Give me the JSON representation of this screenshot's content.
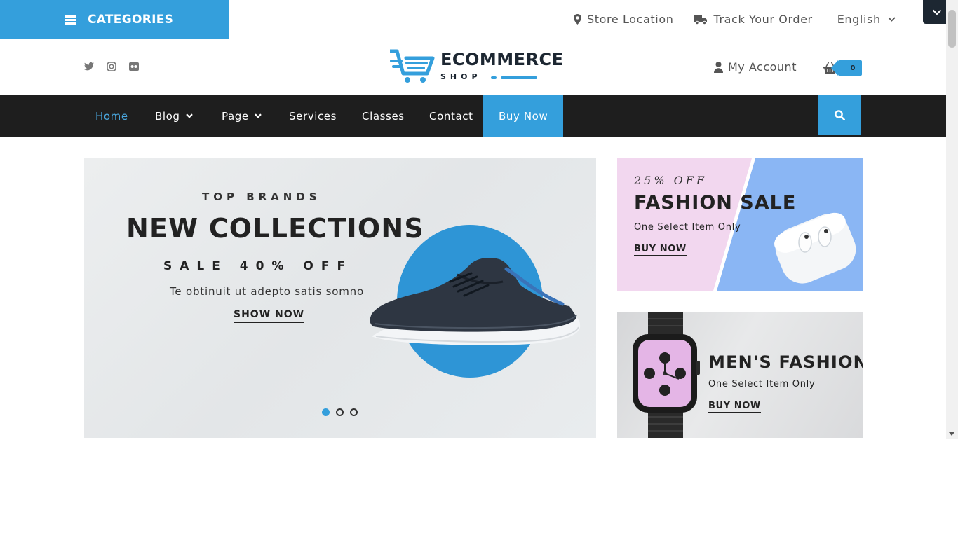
{
  "top_bar": {
    "categories_label": "CATEGORIES",
    "store_location": "Store Location",
    "track_order": "Track Your Order",
    "language": "English"
  },
  "header": {
    "logo_title": "ECOMMERCE",
    "logo_subtitle": "SHOP",
    "social_icons": [
      "twitter-icon",
      "instagram-icon",
      "flickr-icon"
    ],
    "account_label": "My Account",
    "cart_count": "0"
  },
  "nav": {
    "items": [
      {
        "label": "Home",
        "active": true
      },
      {
        "label": "Blog",
        "dropdown": true
      },
      {
        "label": "Page",
        "dropdown": true
      },
      {
        "label": "Services"
      },
      {
        "label": "Classes"
      },
      {
        "label": "Contact"
      }
    ],
    "buy_now": "Buy Now"
  },
  "hero": {
    "subtitle": "TOP BRANDS",
    "title": "NEW COLLECTIONS",
    "sale": "SALE 40% OFF",
    "description": "Te obtinuit ut adepto satis somno",
    "cta": "SHOW NOW",
    "slides": 3,
    "active_slide": 1
  },
  "promo_fashion": {
    "discount": "25% OFF",
    "title": "FASHION SALE",
    "subtitle": "One Select Item Only",
    "cta": "BUY NOW"
  },
  "promo_mens": {
    "title": "MEN'S FASHION",
    "subtitle": "One Select Item Only",
    "cta": "BUY NOW"
  },
  "colors": {
    "accent": "#349fdc",
    "nav_bg": "#1e1e1e",
    "dark": "#1d2732"
  }
}
